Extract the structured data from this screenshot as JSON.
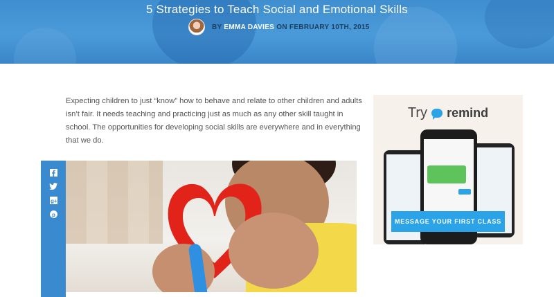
{
  "post": {
    "title": "5 Strategies to Teach Social and Emotional Skills",
    "byline_prefix": "BY",
    "author": "EMMA DAVIES",
    "byline_date": "ON FEBRUARY 10TH, 2015"
  },
  "intro": {
    "paragraph": "Expecting children to just “know” how to behave and relate to other children and adults isn’t fair. It needs teaching and practicing just as much as any other skill taught in school. The opportunities for developing social skills are everywhere and in everything that we do."
  },
  "share": {
    "icons": [
      "facebook-icon",
      "twitter-icon",
      "google-plus-icon",
      "pinterest-icon"
    ],
    "bar_color": "#3a8ad0"
  },
  "ad": {
    "headline_prefix": "Try",
    "brand": "remind",
    "cta_label": "MESSAGE YOUR FIRST CLASS",
    "accent_color": "#2aa3e8"
  },
  "colors": {
    "hero_blue": "#4b9ad8",
    "text": "#555555"
  }
}
